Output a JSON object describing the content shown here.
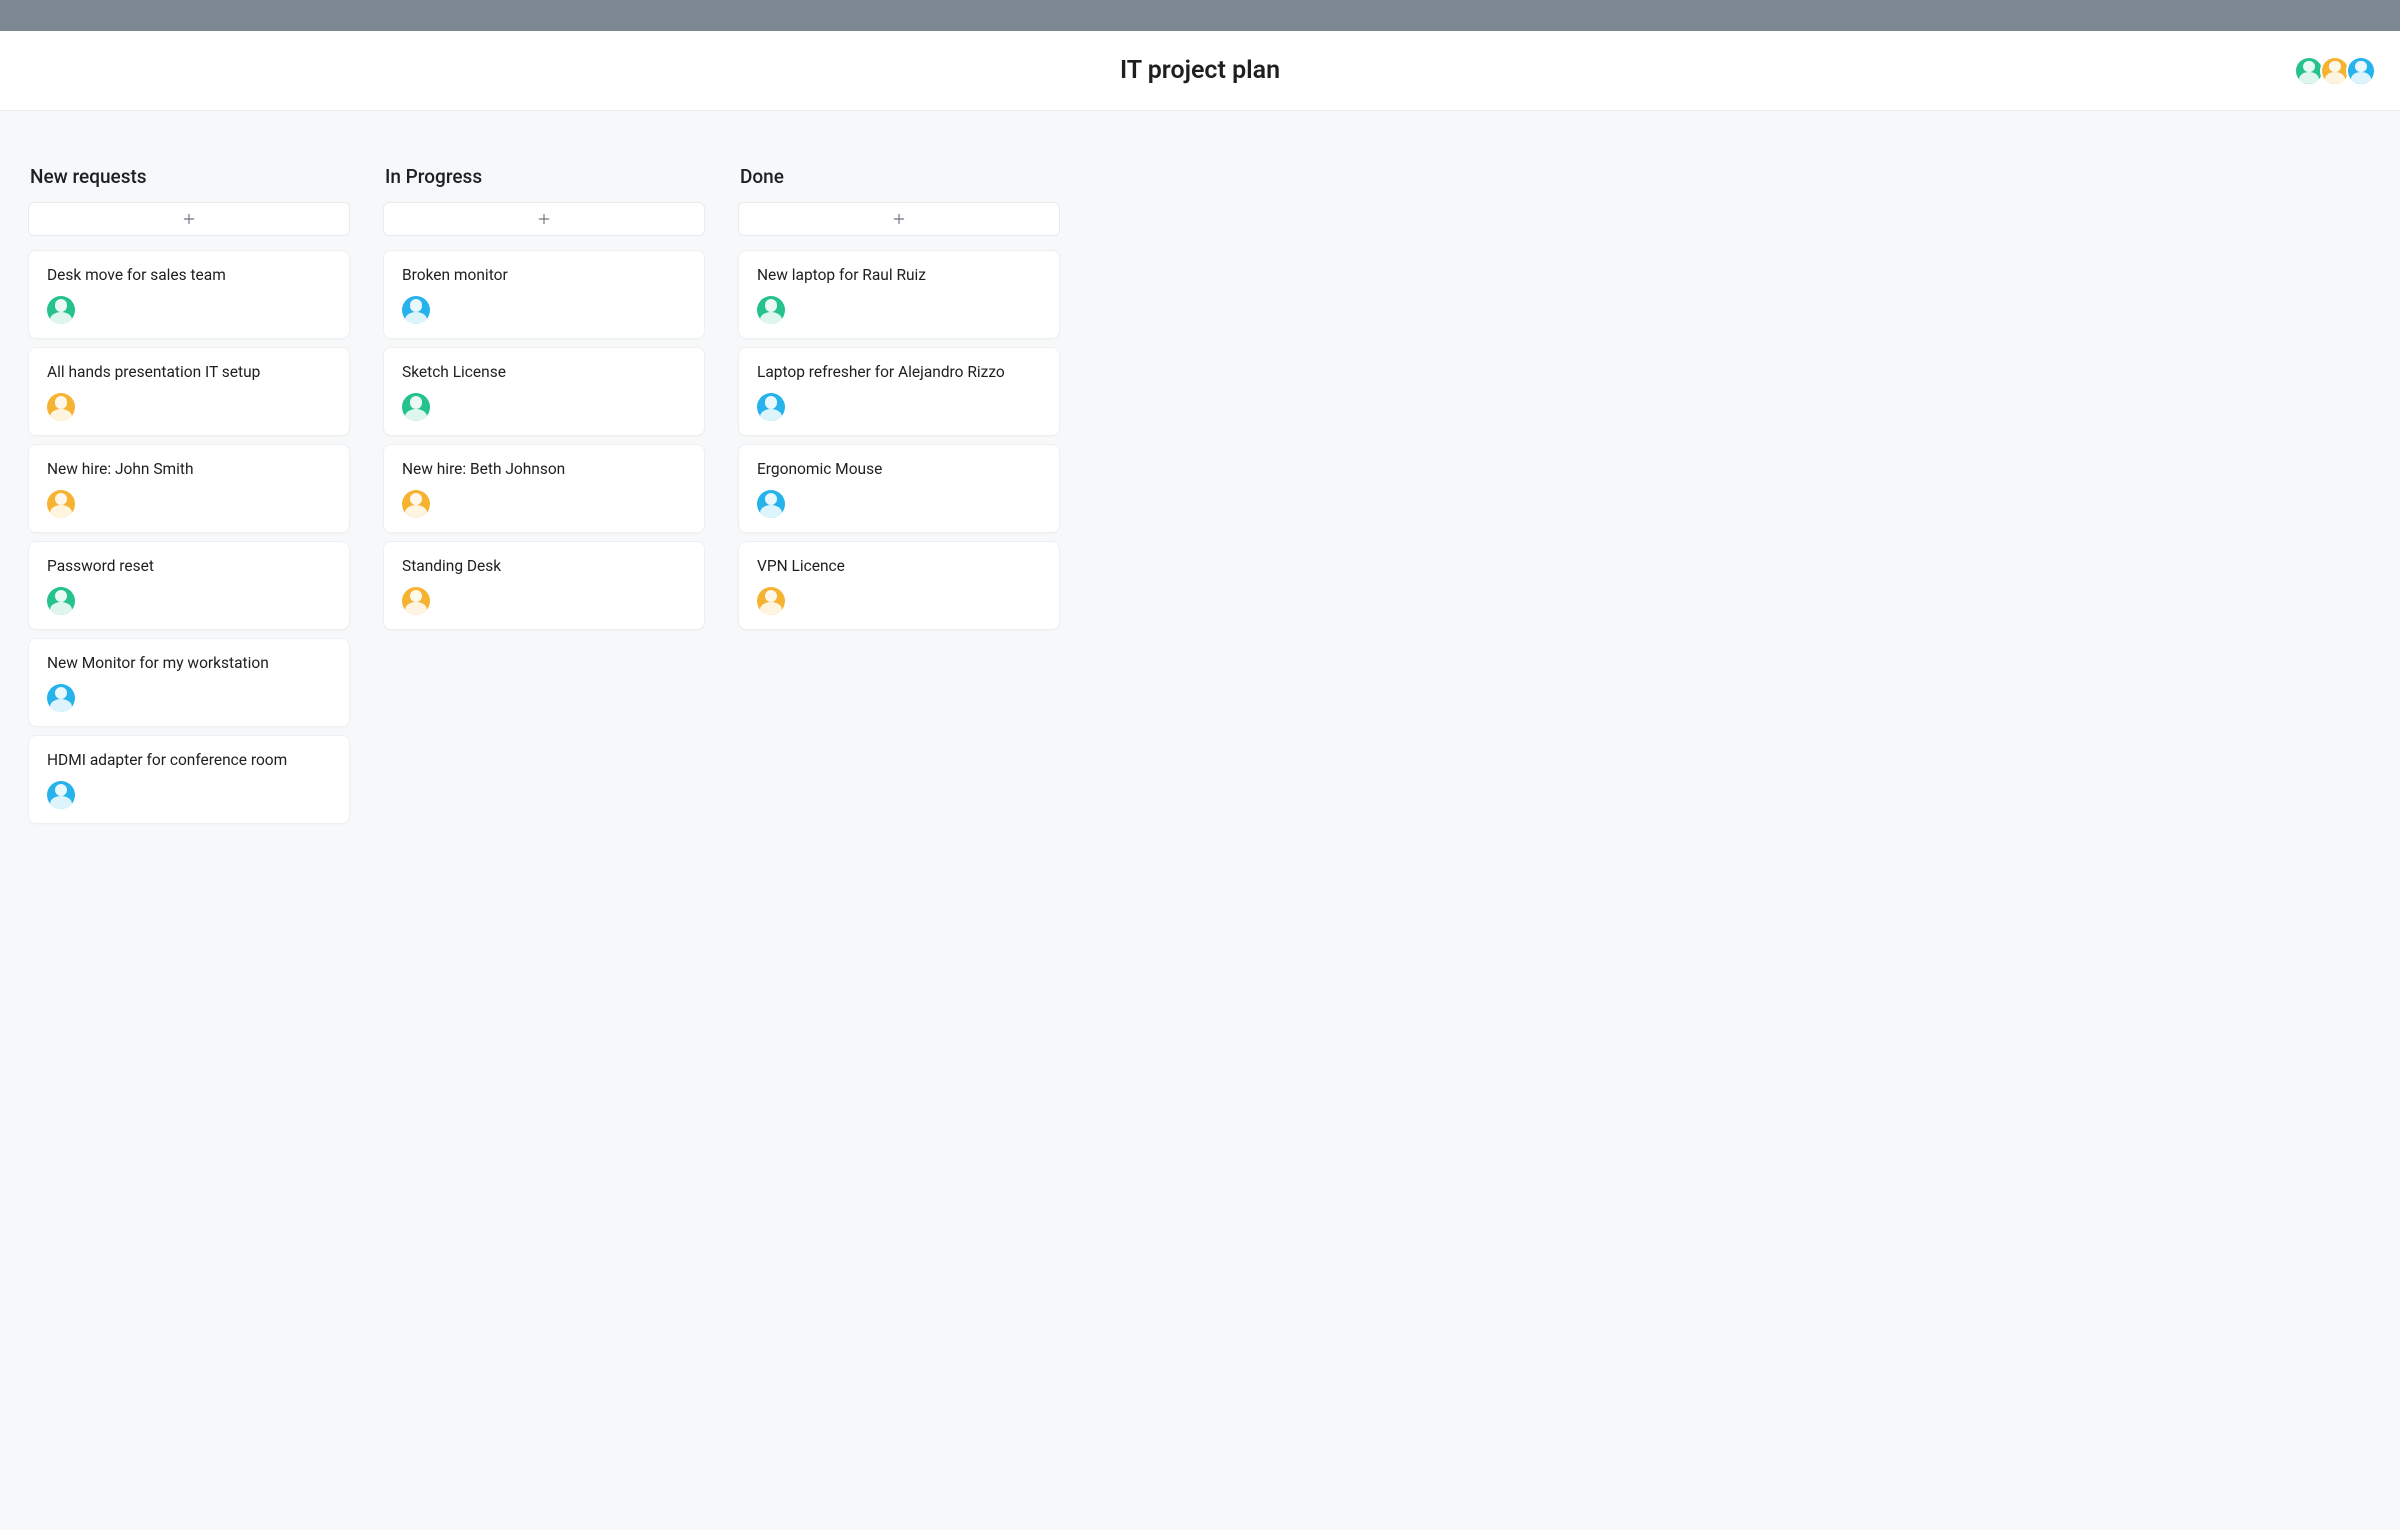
{
  "header": {
    "title": "IT project plan",
    "avatars": [
      "green",
      "orange",
      "blue"
    ]
  },
  "columns": [
    {
      "title": "New requests",
      "cards": [
        {
          "title": "Desk move for sales team",
          "avatar": "green"
        },
        {
          "title": "All hands presentation IT setup",
          "avatar": "orange"
        },
        {
          "title": "New hire: John Smith",
          "avatar": "orange"
        },
        {
          "title": "Password reset",
          "avatar": "green"
        },
        {
          "title": "New Monitor for my workstation",
          "avatar": "blue"
        },
        {
          "title": "HDMI adapter for conference room",
          "avatar": "blue"
        }
      ]
    },
    {
      "title": "In Progress",
      "cards": [
        {
          "title": "Broken monitor",
          "avatar": "blue"
        },
        {
          "title": "Sketch License",
          "avatar": "green"
        },
        {
          "title": "New hire: Beth Johnson",
          "avatar": "orange"
        },
        {
          "title": "Standing Desk",
          "avatar": "orange"
        }
      ]
    },
    {
      "title": "Done",
      "cards": [
        {
          "title": "New laptop for Raul Ruiz",
          "avatar": "green"
        },
        {
          "title": "Laptop refresher for Alejandro Rizzo",
          "avatar": "blue"
        },
        {
          "title": "Ergonomic Mouse",
          "avatar": "blue"
        },
        {
          "title": "VPN Licence",
          "avatar": "orange"
        }
      ]
    }
  ]
}
